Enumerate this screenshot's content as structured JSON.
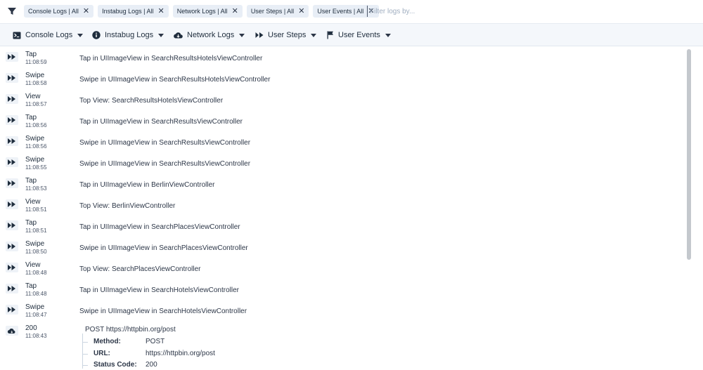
{
  "filters": {
    "chips": [
      "Console Logs | All",
      "Instabug Logs | All",
      "Network Logs | All",
      "User Steps | All",
      "User Events | All"
    ],
    "placeholder": "Filter logs by..."
  },
  "tabs": [
    {
      "label": "Console Logs",
      "icon": "terminal-icon"
    },
    {
      "label": "Instabug Logs",
      "icon": "info-icon"
    },
    {
      "label": "Network Logs",
      "icon": "cloud-icon"
    },
    {
      "label": "User Steps",
      "icon": "steps-icon"
    },
    {
      "label": "User Events",
      "icon": "flag-icon"
    }
  ],
  "logs": [
    {
      "type": "Tap",
      "time": "11:08:59",
      "msg": "Tap in UIImageView in SearchResultsHotelsViewController"
    },
    {
      "type": "Swipe",
      "time": "11:08:58",
      "msg": "Swipe in UIImageView in SearchResultsHotelsViewController"
    },
    {
      "type": "View",
      "time": "11:08:57",
      "msg": "Top View: SearchResultsHotelsViewController"
    },
    {
      "type": "Tap",
      "time": "11:08:56",
      "msg": "Tap in UIImageView in SearchResultsViewController"
    },
    {
      "type": "Swipe",
      "time": "11:08:56",
      "msg": "Swipe in UIImageView in SearchResultsViewController"
    },
    {
      "type": "Swipe",
      "time": "11:08:55",
      "msg": "Swipe in UIImageView in SearchResultsViewController"
    },
    {
      "type": "Tap",
      "time": "11:08:53",
      "msg": "Tap in UIImageView in BerlinViewController"
    },
    {
      "type": "View",
      "time": "11:08:51",
      "msg": "Top View: BerlinViewController"
    },
    {
      "type": "Tap",
      "time": "11:08:51",
      "msg": "Tap in UIImageView in SearchPlacesViewController"
    },
    {
      "type": "Swipe",
      "time": "11:08:50",
      "msg": "Swipe in UIImageView in SearchPlacesViewController"
    },
    {
      "type": "View",
      "time": "11:08:48",
      "msg": "Top View: SearchPlacesViewController"
    },
    {
      "type": "Tap",
      "time": "11:08:48",
      "msg": "Tap in UIImageView in SearchHotelsViewController"
    },
    {
      "type": "Swipe",
      "time": "11:08:47",
      "msg": "Swipe in UIImageView in SearchHotelsViewController"
    }
  ],
  "network": {
    "status": "200",
    "time": "11:08:43",
    "request": "POST https://httpbin.org/post",
    "details": [
      {
        "key": "Method:",
        "value": "POST"
      },
      {
        "key": "URL:",
        "value": "https://httpbin.org/post"
      },
      {
        "key": "Status Code:",
        "value": "200"
      }
    ]
  },
  "colors": {
    "chip_bg": "#e8eef6",
    "tabs_bg": "#f4f7fb",
    "icon": "#1f2d3d"
  }
}
